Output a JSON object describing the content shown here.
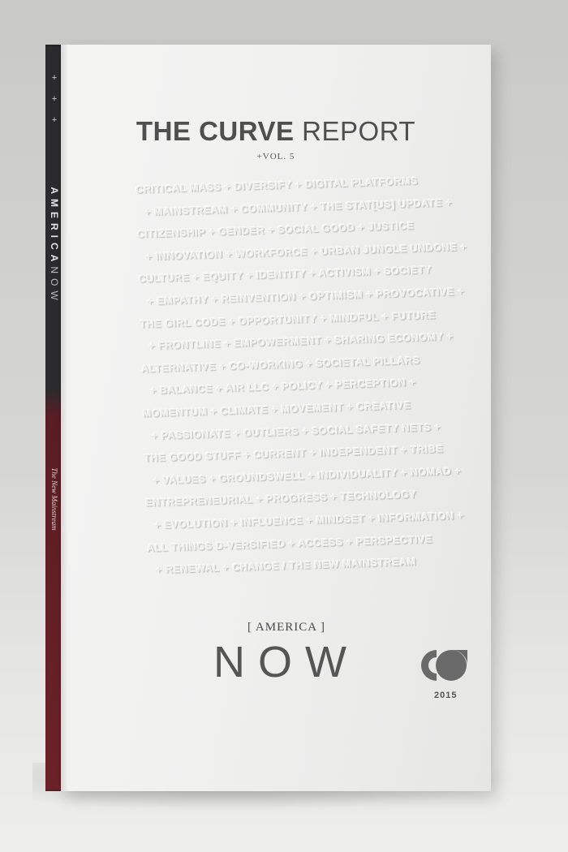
{
  "spine": {
    "title_bold": "AMERICA",
    "title_light": "NOW",
    "subtitle": "The New Mainstream"
  },
  "cover": {
    "title_bold": "THE CURVE",
    "title_light": "REPORT",
    "volume": "+VOL. 5",
    "embossed_lines": [
      "CRITICAL MASS + DIVERSIFY + DIGITAL PLATFORMS",
      "+ MAINSTREAM + COMMUNITY + THE STAT[US] UPDATE +",
      "CITIZENSHIP + GENDER + SOCIAL GOOD + JUSTICE",
      "+ INNOVATION + WORKFORCE + URBAN JUNGLE UNDONE +",
      "CULTURE + EQUITY + IDENTITY + ACTIVISM + SOCIETY",
      "+ EMPATHY + REINVENTION + OPTIMISM + PROVOCATIVE +",
      "THE GIRL CODE + OPPORTUNITY + MINDFUL + FUTURE",
      "+ FRONTLINE + EMPOWERMENT + SHARING ECONOMY +",
      "ALTERNATIVE + CO-WORKING + SOCIETAL PILLARS",
      "+ BALANCE + AIR LLC + POLICY + PERCEPTION +",
      "MOMENTUM + CLIMATE + MOVEMENT + CREATIVE",
      "+ PASSIONATE + OUTLIERS + SOCIAL SAFETY NETS +",
      "THE GOOD STUFF + CURRENT + INDEPENDENT + TRIBE",
      "+ VALUES + GROUNDSWELL + INDIVIDUALITY + NOMAD +",
      "ENTREPRENEURIAL + PROGRESS + TECHNOLOGY",
      "+ EVOLUTION + INFLUENCE + MINDSET + INFORMATION +",
      "ALL THINGS D-VERSIFIED + ACCESS + PERSPECTIVE",
      "+ RENEWAL + CHANGE / THE NEW MAINSTREAM"
    ],
    "america_label": "[ AMERICA ]",
    "now_label": "NOW",
    "logo_icon": "co-logo-icon",
    "year": "2015"
  },
  "colors": {
    "spine_dark": "#2b2b2d",
    "spine_red": "#6d2229",
    "cover": "#f1f1f0",
    "ink": "#555555"
  }
}
